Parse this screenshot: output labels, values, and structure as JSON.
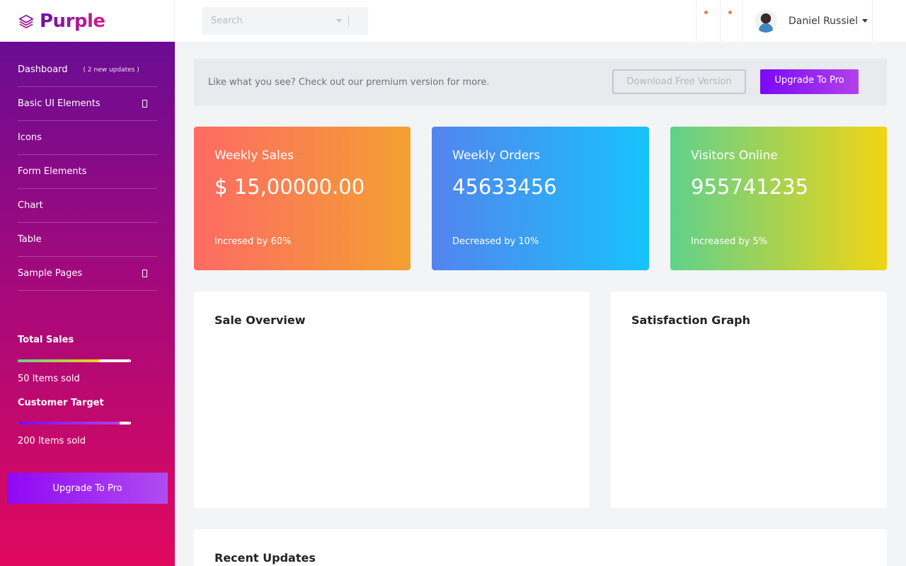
{
  "brand": {
    "name": "Purple"
  },
  "search": {
    "placeholder": "Search"
  },
  "user": {
    "name": "Daniel Russiel"
  },
  "sidebar": {
    "items": [
      {
        "label": "Dashboard",
        "badge": "( 2 new updates )"
      },
      {
        "label": "Basic UI Elements",
        "expandable": true
      },
      {
        "label": "Icons"
      },
      {
        "label": "Form Elements"
      },
      {
        "label": "Chart"
      },
      {
        "label": "Table"
      },
      {
        "label": "Sample Pages",
        "expandable": true
      }
    ],
    "total_sales": {
      "title": "Total Sales",
      "subtitle": "50 Items sold",
      "progress": 0.72
    },
    "customer_target": {
      "title": "Customer Target",
      "subtitle": "200 Items sold",
      "progress": 0.9
    },
    "upgrade_button": "Upgrade To Pro"
  },
  "banner": {
    "text": "Like what you see? Check out our premium version for more.",
    "download_button": "Download Free Version",
    "upgrade_button": "Upgrade To Pro"
  },
  "cards": [
    {
      "label": "Weekly Sales",
      "value": "$ 15,00000.00",
      "note": "Incresed by 60%",
      "gradient": [
        "#fe6b64",
        "#f3a032"
      ]
    },
    {
      "label": "Weekly Orders",
      "value": "45633456",
      "note": "Decreased by 10%",
      "gradient": [
        "#5384ee",
        "#18c3fb"
      ]
    },
    {
      "label": "Visitors Online",
      "value": "955741235",
      "note": "Increased by 5%",
      "gradient": [
        "#60d18c",
        "#f1d414"
      ]
    }
  ],
  "panels": {
    "sale_overview": "Sale Overview",
    "satisfaction_graph": "Satisfaction Graph",
    "recent_updates": "Recent Updates"
  },
  "colors": {
    "accent": "#8f08f4",
    "notification_dot": "#f07e3c"
  }
}
